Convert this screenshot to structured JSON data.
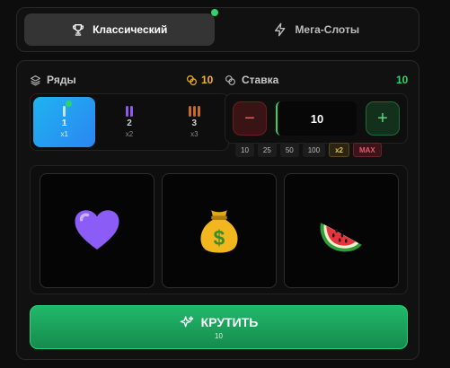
{
  "modes": [
    {
      "label": "Классический",
      "icon": "trophy-icon",
      "active": true
    },
    {
      "label": "Мега-Слоты",
      "icon": "lightning-icon",
      "active": false
    }
  ],
  "rows": {
    "title": "Ряды",
    "coins": "10",
    "options": [
      {
        "num": "1",
        "mult": "x1",
        "active": true,
        "bar_color": "#bfe6ff"
      },
      {
        "num": "2",
        "mult": "x2",
        "active": false,
        "bar_color": "#8f5be6"
      },
      {
        "num": "3",
        "mult": "x3",
        "active": false,
        "bar_color": "#c46a2a"
      }
    ]
  },
  "bet": {
    "title": "Ставка",
    "total": "10",
    "value": "10",
    "minus": "−",
    "plus": "+",
    "chips": [
      "10",
      "25",
      "50",
      "100",
      "x2",
      "MAX"
    ]
  },
  "reels": [
    "heart-icon",
    "money-bag-icon",
    "watermelon-icon"
  ],
  "spin": {
    "label": "КРУТИТЬ",
    "cost": "10"
  },
  "colors": {
    "accent_green": "#2fd36b",
    "active_blue": "#1fb3ef",
    "coin_gold": "#f0b323"
  }
}
